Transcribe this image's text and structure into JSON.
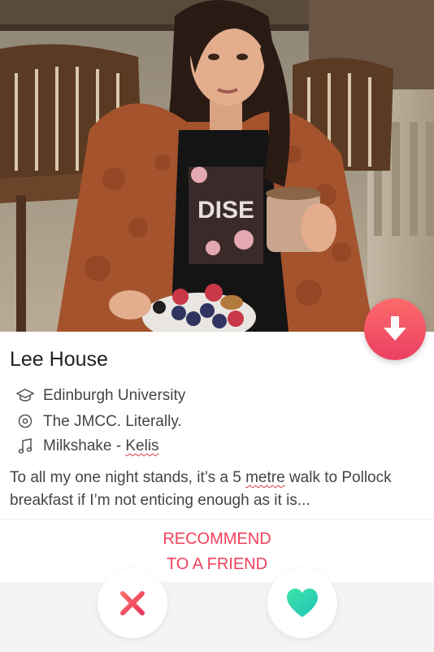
{
  "profile": {
    "name": "Lee House",
    "school": "Edinburgh University",
    "work": "The JMCC. Literally.",
    "anthem_title": "Milkshake - ",
    "anthem_artist": "Kelis",
    "bio_part1": "To all my one night stands, it’s a 5 ",
    "bio_word_flagged": "metre",
    "bio_part2": " walk to Pollock breakfast if I’m not enticing enough as it is..."
  },
  "actions": {
    "recommend_line1": "RECOMMEND",
    "recommend_line2": "TO A FRIEND"
  },
  "icons": {
    "school": "graduation-cap-icon",
    "location": "location-pin-icon",
    "music": "music-note-icon",
    "collapse": "arrow-down-icon",
    "nope": "x-icon",
    "like": "heart-icon"
  },
  "colors": {
    "accent": "#f0425c",
    "like": "#2fd4b0"
  }
}
